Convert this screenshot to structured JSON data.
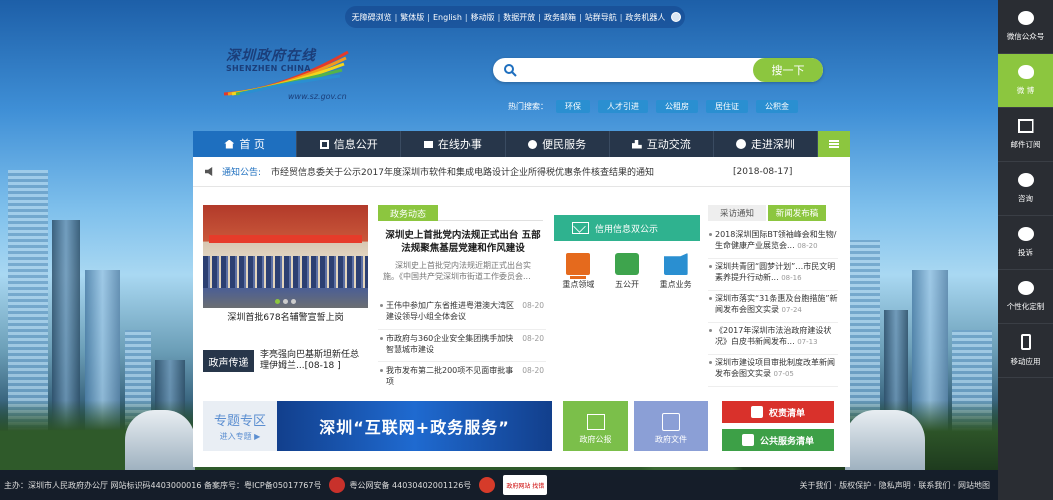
{
  "top_links": [
    "无障碍浏览",
    "繁体版",
    "English",
    "移动版",
    "数据开放",
    "政务邮箱",
    "站群导航",
    "政务机器人"
  ],
  "logo": {
    "cn": "深圳政府在线",
    "en": "SHENZHEN CHINA",
    "url": "www.sz.gov.cn"
  },
  "search": {
    "placeholder": "",
    "button": "搜一下",
    "hot_label": "热门搜索：",
    "hot_tags": [
      "环保",
      "人才引进",
      "公租房",
      "居住证",
      "公积金"
    ]
  },
  "nav": [
    "首 页",
    "信息公开",
    "在线办事",
    "便民服务",
    "互动交流",
    "走进深圳"
  ],
  "notice": {
    "label": "通知公告:",
    "text": "市经贸信息委关于公示2017年度深圳市软件和集成电路设计企业所得税优惠条件核查结果的通知",
    "date": "[2018-08-17]"
  },
  "photo_caption": "深圳首批678名辅警宣誓上岗",
  "voice": {
    "label": "政声传递",
    "text": "李亮强向巴基斯坦新任总理伊姆兰...[08-18 ]"
  },
  "gov_news": {
    "tab": "政务动态",
    "headline": "深圳史上首批党内法规正式出台 五部法规聚焦基层党建和作风建设",
    "summary": "深圳史上首批党内法规近期正式出台实施。《中国共产党深圳市街道工作委员会...",
    "items": [
      {
        "text": "王伟中参加广东省推进粤港澳大湾区建设领导小组全体会议",
        "date": "08-20"
      },
      {
        "text": "市政府与360企业安全集团携手加快智慧城市建设",
        "date": "08-20"
      },
      {
        "text": "我市发布第二批200项不见面审批事项",
        "date": "08-20"
      }
    ]
  },
  "credit": {
    "title": "信用信息双公示",
    "icons": [
      "重点领域",
      "五公开",
      "重点业务"
    ]
  },
  "right_col": {
    "tabs": [
      "采访通知",
      "新闻发布稿"
    ],
    "items": [
      {
        "text": "2018深圳国际BT领袖峰会和生物/生命健康产业展览会...",
        "date": "08-20"
      },
      {
        "text": "深圳共青团“圆梦计划”…市民文明素养提升行动新...",
        "date": "08-16"
      },
      {
        "text": "深圳市落实“31条惠及台胞措施”新闻发布会图文实录",
        "date": "07-24"
      },
      {
        "text": "《2017年深圳市法治政府建设状况》白皮书新闻发布...",
        "date": "07-13"
      },
      {
        "text": "深圳市建设项目审批制度改革新闻发布会图文实录",
        "date": "07-05"
      }
    ]
  },
  "banners": {
    "zhuanti": "专题专区",
    "zhuanti_enter": "进入专题 ▶",
    "netgov": "深圳“互联网+政务服务”",
    "gazette": "政府公报",
    "docs": "政府文件",
    "rights": "权责清单",
    "pubserv": "公共服务清单"
  },
  "sidebar": [
    "微信公众号",
    "微 博",
    "邮件订阅",
    "咨询",
    "投诉",
    "个性化定制",
    "移动应用"
  ],
  "footer": {
    "left": "主办：深圳市人民政府办公厅  网站标识码4403000016  备案序号：粤ICP备05017767号",
    "police": "粤公网安备 44030402001126号",
    "gov_badge": "政府网站 找错",
    "right": "关于我们 · 版权保护 · 隐私声明 · 联系我们 · 网站地图"
  }
}
